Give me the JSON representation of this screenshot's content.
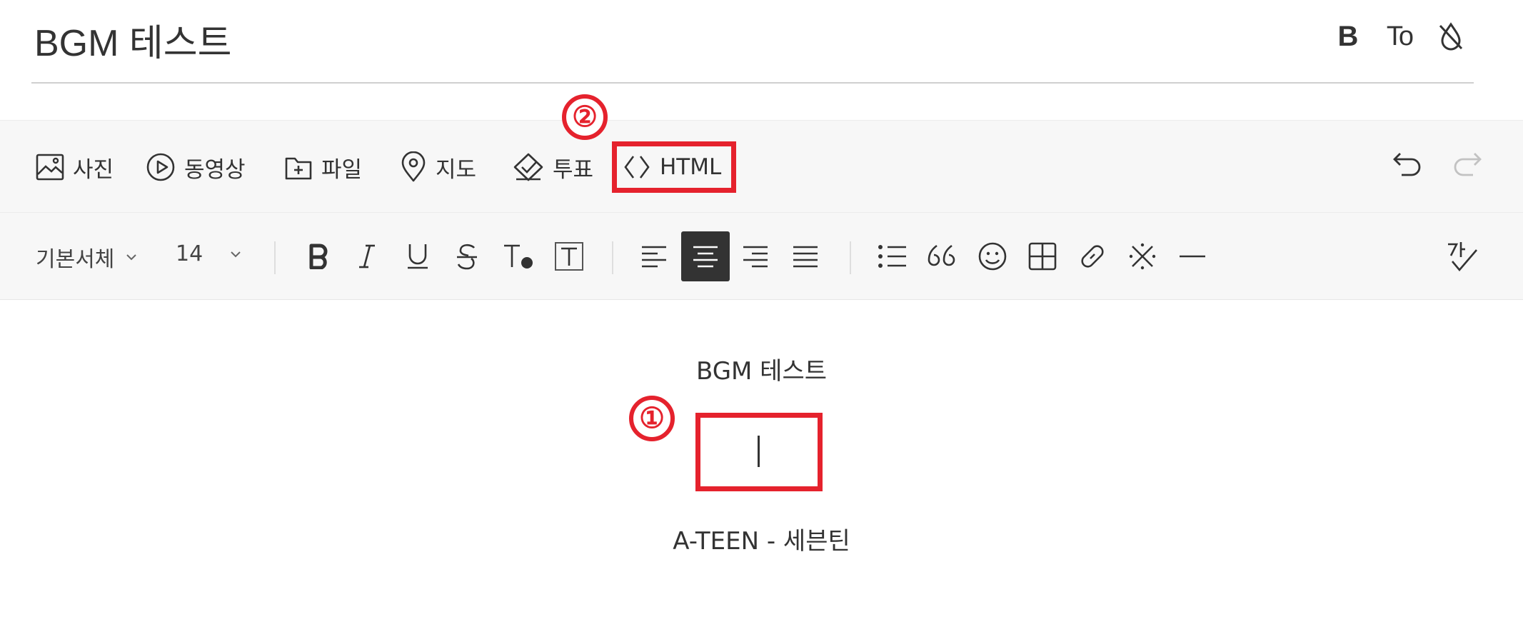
{
  "post": {
    "title": "BGM 테스트"
  },
  "title_tools": {
    "bold_label": "B",
    "text_style_label": "To",
    "color_icon": "drop-slash-icon"
  },
  "insert_toolbar": {
    "items": [
      {
        "label": "사진",
        "icon": "image-icon"
      },
      {
        "label": "동영상",
        "icon": "play-circle-icon"
      },
      {
        "label": "파일",
        "icon": "folder-plus-icon"
      },
      {
        "label": "지도",
        "icon": "map-pin-icon"
      },
      {
        "label": "투표",
        "icon": "vote-check-icon"
      },
      {
        "label": "HTML",
        "icon": "code-brackets-icon"
      }
    ],
    "undo_icon": "undo-icon",
    "redo_icon": "redo-icon"
  },
  "format_toolbar": {
    "font_family": "기본서체",
    "font_size": "14",
    "spell_check_icon": "spellcheck-icon",
    "active_alignment": "center"
  },
  "content": {
    "heading_line": "BGM 테스트",
    "song_line": "A-TEEN - 세븐틴"
  },
  "annotations": {
    "badge_1": "①",
    "badge_2": "②",
    "highlight_color": "#e5222d"
  }
}
